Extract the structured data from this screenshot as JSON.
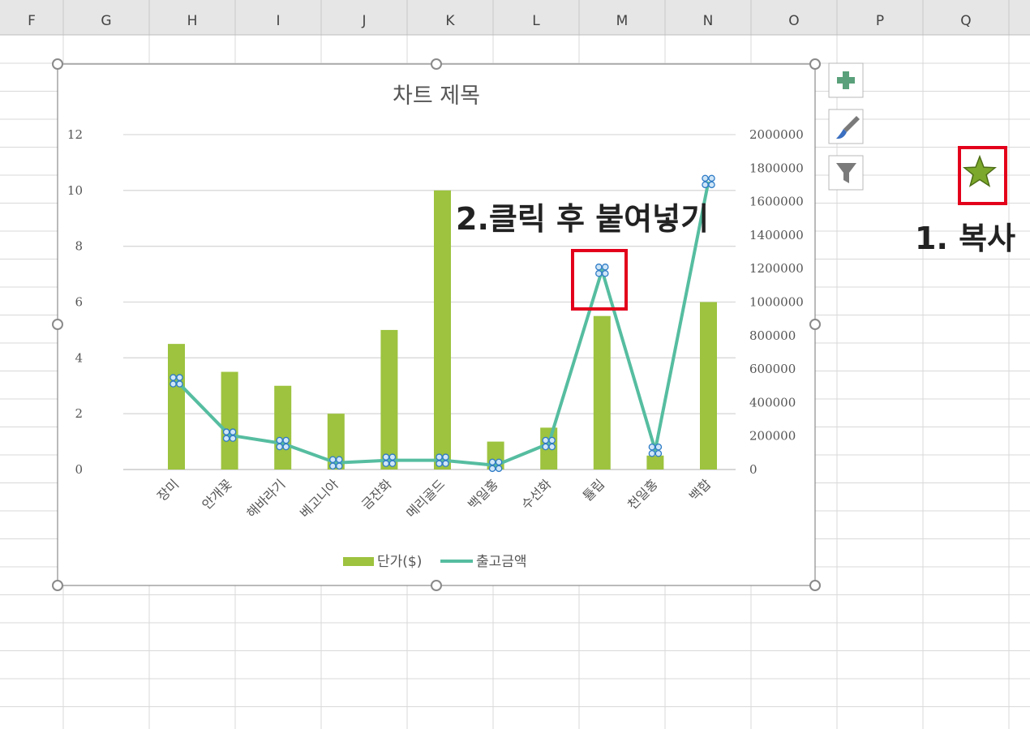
{
  "columns": [
    "F",
    "G",
    "H",
    "I",
    "J",
    "K",
    "L",
    "M",
    "N",
    "O",
    "P",
    "Q"
  ],
  "side_buttons": [
    {
      "name": "chart-elements-button",
      "icon": "plus-icon"
    },
    {
      "name": "chart-styles-button",
      "icon": "brush-icon"
    },
    {
      "name": "chart-filters-button",
      "icon": "filter-icon"
    }
  ],
  "annotations": {
    "step1": "1. 복사",
    "step2": "2.클릭 후 붙여넣기",
    "step1_icon": "star-icon"
  },
  "colors": {
    "bar": "#9dc33f",
    "line": "#56bda0",
    "highlight": "#e3001b",
    "star": "#7ca82b"
  },
  "chart_data": {
    "type": "bar",
    "title": "차트 제목",
    "categories": [
      "장미",
      "안개꽃",
      "해바라기",
      "베고니아",
      "금잔화",
      "메리골드",
      "백일홍",
      "수선화",
      "튤립",
      "천일홍",
      "백합"
    ],
    "series": [
      {
        "name": "단가($)",
        "type": "bar",
        "axis": "left",
        "values": [
          4.5,
          3.5,
          3,
          2,
          5,
          10,
          1,
          1.5,
          5.5,
          0.5,
          6
        ]
      },
      {
        "name": "출고금액",
        "type": "line",
        "axis": "right",
        "values": [
          530000,
          205000,
          155000,
          40000,
          55000,
          55000,
          25000,
          155000,
          1190000,
          115000,
          1720000
        ]
      }
    ],
    "y_left": {
      "min": 0,
      "max": 12,
      "ticks": [
        0,
        2,
        4,
        6,
        8,
        10,
        12
      ]
    },
    "y_right": {
      "min": 0,
      "max": 2000000,
      "ticks": [
        "0",
        "200000",
        "400000",
        "600000",
        "800000",
        "1000000",
        "1200000",
        "1400000",
        "1600000",
        "1800000",
        "2000000"
      ]
    },
    "legend": {
      "position": "bottom"
    },
    "grid": true
  }
}
